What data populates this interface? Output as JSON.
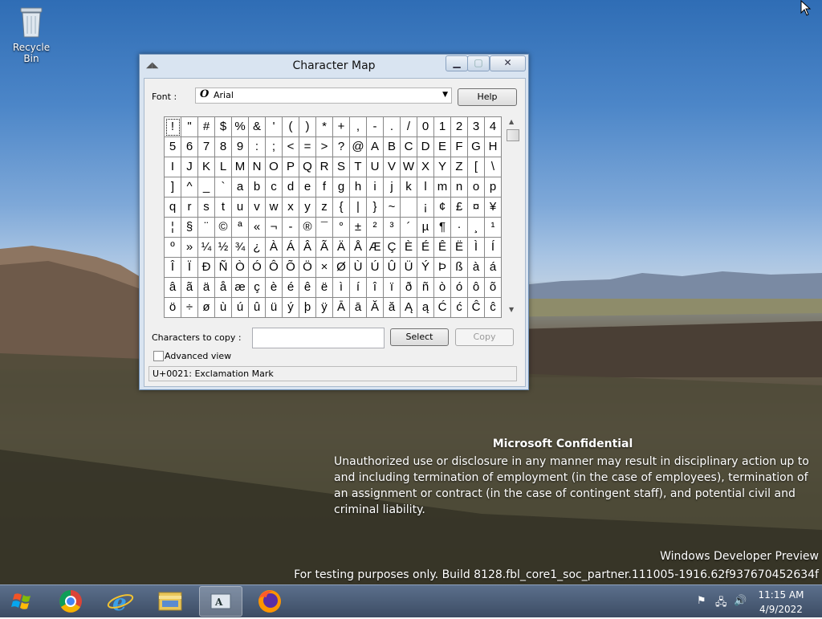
{
  "desktop": {
    "icons": [
      {
        "label": "Recycle Bin",
        "icon": "recycle-bin-icon"
      }
    ],
    "watermark": {
      "title": "Microsoft Confidential",
      "body": "Unauthorized use or disclosure in any manner may result in disciplinary action up to and including termination of employment (in the case of employees), termination of an assignment or contract (in the case of contingent staff), and potential civil and criminal liability.",
      "edition": "Windows Developer Preview",
      "build": "For testing purposes only. Build 8128.fbl_core1_soc_partner.111005-1916.62f937670452634f"
    }
  },
  "window": {
    "title": "Character Map",
    "font_label": "Font :",
    "font_value": "Arial",
    "font_icon_glyph": "O",
    "help_label": "Help",
    "characters": [
      [
        "!",
        "\"",
        "#",
        "$",
        "%",
        "&",
        "'",
        "(",
        ")",
        "*",
        "+",
        ",",
        "-",
        ".",
        "/",
        "0",
        "1",
        "2",
        "3",
        "4"
      ],
      [
        "5",
        "6",
        "7",
        "8",
        "9",
        ":",
        ";",
        "<",
        "=",
        ">",
        "?",
        "@",
        "A",
        "B",
        "C",
        "D",
        "E",
        "F",
        "G",
        "H"
      ],
      [
        "I",
        "J",
        "K",
        "L",
        "M",
        "N",
        "O",
        "P",
        "Q",
        "R",
        "S",
        "T",
        "U",
        "V",
        "W",
        "X",
        "Y",
        "Z",
        "[",
        "\\"
      ],
      [
        "]",
        "^",
        "_",
        "`",
        "a",
        "b",
        "c",
        "d",
        "e",
        "f",
        "g",
        "h",
        "i",
        "j",
        "k",
        "l",
        "m",
        "n",
        "o",
        "p"
      ],
      [
        "q",
        "r",
        "s",
        "t",
        "u",
        "v",
        "w",
        "x",
        "y",
        "z",
        "{",
        "|",
        "}",
        "~",
        " ",
        "¡",
        "¢",
        "£",
        "¤",
        "¥"
      ],
      [
        "¦",
        "§",
        "¨",
        "©",
        "ª",
        "«",
        "¬",
        "-",
        "®",
        "¯",
        "°",
        "±",
        "²",
        "³",
        "´",
        "µ",
        "¶",
        "·",
        "¸",
        "¹"
      ],
      [
        "º",
        "»",
        "¼",
        "½",
        "¾",
        "¿",
        "À",
        "Á",
        "Â",
        "Ã",
        "Ä",
        "Å",
        "Æ",
        "Ç",
        "È",
        "É",
        "Ê",
        "Ë",
        "Ì",
        "Í"
      ],
      [
        "Î",
        "Ï",
        "Ð",
        "Ñ",
        "Ò",
        "Ó",
        "Ô",
        "Õ",
        "Ö",
        "×",
        "Ø",
        "Ù",
        "Ú",
        "Û",
        "Ü",
        "Ý",
        "Þ",
        "ß",
        "à",
        "á"
      ],
      [
        "â",
        "ã",
        "ä",
        "å",
        "æ",
        "ç",
        "è",
        "é",
        "ê",
        "ë",
        "ì",
        "í",
        "î",
        "ï",
        "ð",
        "ñ",
        "ò",
        "ó",
        "ô",
        "õ"
      ],
      [
        "ö",
        "÷",
        "ø",
        "ù",
        "ú",
        "û",
        "ü",
        "ý",
        "þ",
        "ÿ",
        "Ā",
        "ā",
        "Ă",
        "ă",
        "Ą",
        "ą",
        "Ć",
        "ć",
        "Ĉ",
        "ĉ"
      ]
    ],
    "selected_char": "!",
    "copy_label": "Characters to copy :",
    "copy_value": "",
    "select_label": "Select",
    "copy_btn_label": "Copy",
    "advanced_label": "Advanced view",
    "advanced_checked": false,
    "status": "U+0021: Exclamation Mark"
  },
  "taskbar": {
    "items": [
      "start-button",
      "chrome-icon",
      "internet-explorer-icon",
      "file-explorer-icon",
      "character-map-icon",
      "firefox-icon"
    ],
    "active_item": "character-map-icon",
    "clock_time": "11:15 AM",
    "clock_date": "4/9/2022"
  }
}
